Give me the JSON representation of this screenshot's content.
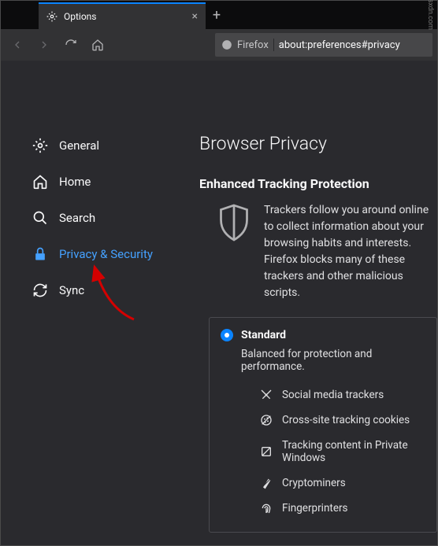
{
  "tab": {
    "title": "Options"
  },
  "urlbar": {
    "product": "Firefox",
    "address": "about:preferences#privacy"
  },
  "sidebar": {
    "items": [
      {
        "label": "General"
      },
      {
        "label": "Home"
      },
      {
        "label": "Search"
      },
      {
        "label": "Privacy & Security"
      },
      {
        "label": "Sync"
      }
    ]
  },
  "main": {
    "heading": "Browser Privacy",
    "subheading": "Enhanced Tracking Protection",
    "intro": "Trackers follow you around online to collect information about your browsing habits and interests. Firefox blocks many of these trackers and other malicious scripts.",
    "card": {
      "title": "Standard",
      "subtitle": "Balanced for protection and performance.",
      "items": [
        "Social media trackers",
        "Cross-site tracking cookies",
        "Tracking content in Private Windows",
        "Cryptominers",
        "Fingerprinters"
      ]
    }
  },
  "watermark": "wsxdn.com"
}
